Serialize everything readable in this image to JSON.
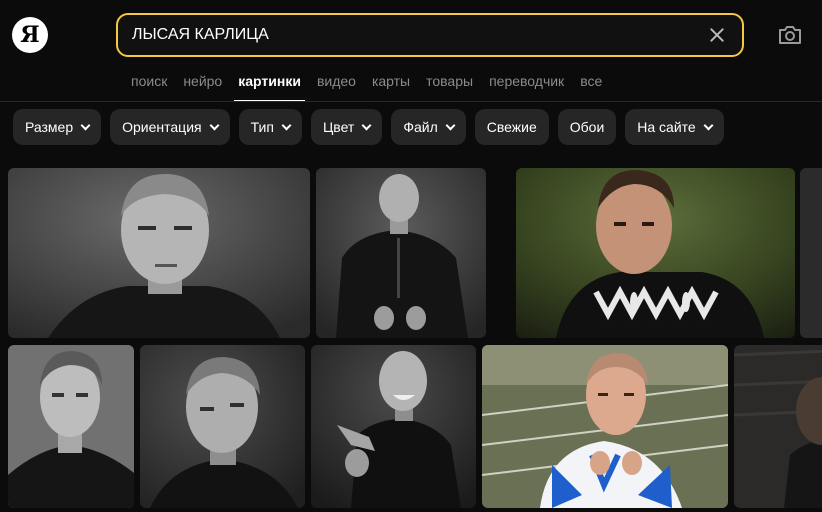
{
  "logo": {
    "letter": "Я"
  },
  "search": {
    "value": "ЛЫСАЯ КАРЛИЦА"
  },
  "icons": {
    "clear": "close-icon",
    "camera": "camera-icon"
  },
  "tabs": [
    {
      "label": "поиск",
      "active": false
    },
    {
      "label": "нейро",
      "active": false
    },
    {
      "label": "картинки",
      "active": true
    },
    {
      "label": "видео",
      "active": false
    },
    {
      "label": "карты",
      "active": false
    },
    {
      "label": "товары",
      "active": false
    },
    {
      "label": "переводчик",
      "active": false
    },
    {
      "label": "все",
      "active": false
    }
  ],
  "filters": [
    {
      "label": "Размер",
      "dropdown": true
    },
    {
      "label": "Ориентация",
      "dropdown": true
    },
    {
      "label": "Тип",
      "dropdown": true
    },
    {
      "label": "Цвет",
      "dropdown": true
    },
    {
      "label": "Файл",
      "dropdown": true
    },
    {
      "label": "Свежие",
      "dropdown": false
    },
    {
      "label": "Обои",
      "dropdown": false
    },
    {
      "label": "На сайте",
      "dropdown": true
    }
  ],
  "colors": {
    "accent": "#f5c842",
    "background": "#0b0b0b",
    "chip": "#262626"
  }
}
